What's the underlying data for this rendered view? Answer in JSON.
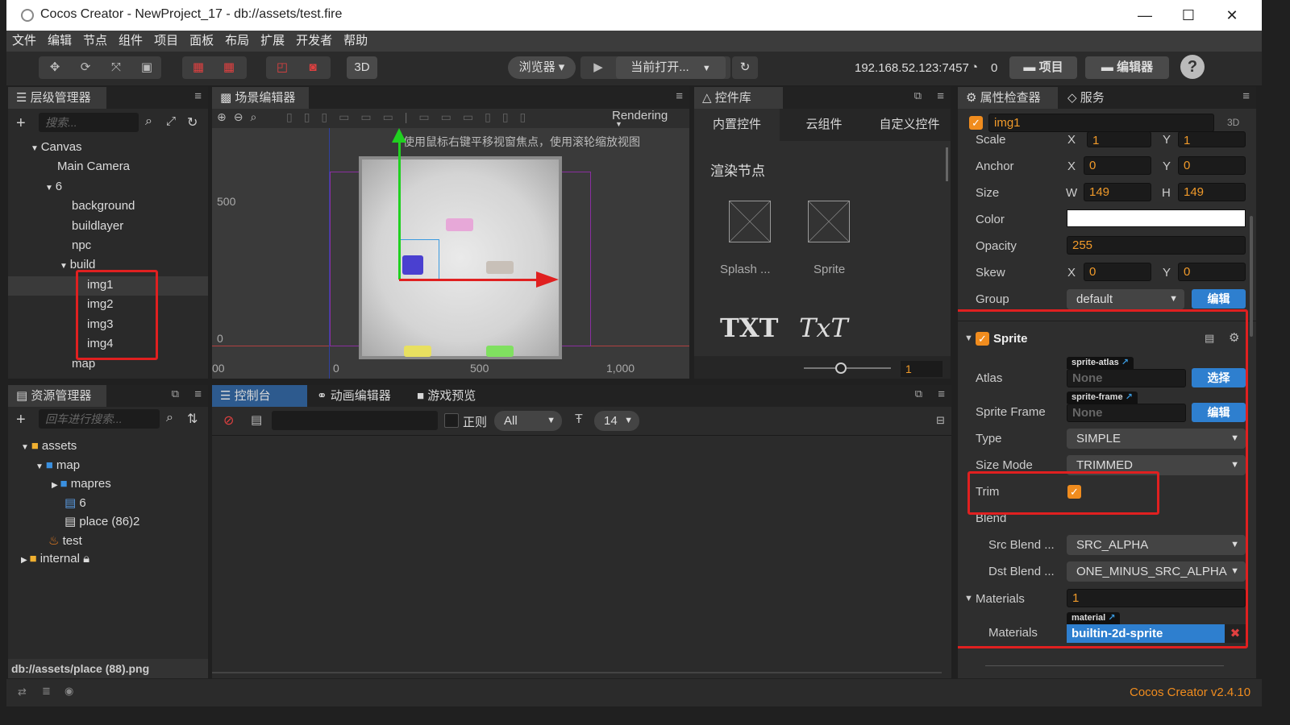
{
  "window": {
    "title": "Cocos Creator - NewProject_17 - db://assets/test.fire"
  },
  "menu": [
    "文件",
    "编辑",
    "节点",
    "组件",
    "项目",
    "面板",
    "布局",
    "扩展",
    "开发者",
    "帮助"
  ],
  "toolbar": {
    "mode_3d": "3D",
    "browser": "浏览器 ▾",
    "current_open": "当前打开...",
    "ip": "192.168.52.123:7457",
    "conn_count": "0",
    "project_btn": "项目",
    "editor_btn": "编辑器"
  },
  "hierarchy": {
    "title": "层级管理器",
    "search_placeholder": "搜索...",
    "nodes": [
      "Canvas",
      "Main Camera",
      "6",
      "background",
      "buildlayer",
      "npc",
      "build",
      "img1",
      "img2",
      "img3",
      "img4",
      "map"
    ]
  },
  "scene": {
    "title": "场景编辑器",
    "rendering": "Rendering",
    "hint": "使用鼠标右键平移视窗焦点，使用滚轮缩放视图",
    "y_labels": [
      "500",
      "0"
    ],
    "x_labels": [
      "00",
      "0",
      "500",
      "1,000"
    ]
  },
  "widgets": {
    "title": "控件库",
    "tabs": [
      "内置控件",
      "云组件",
      "自定义控件"
    ],
    "section": "渲染节点",
    "items": [
      "Splash ...",
      "Sprite"
    ],
    "zoom_value": "1",
    "txt1": "TXT",
    "txt2": "TxT"
  },
  "assets": {
    "title": "资源管理器",
    "search_placeholder": "回车进行搜索...",
    "items": [
      "assets",
      "map",
      "mapres",
      "6",
      "place (86)2",
      "test",
      "internal"
    ],
    "status_path": "db://assets/place (88).png"
  },
  "console": {
    "tabs": [
      "控制台",
      "动画编辑器",
      "游戏预览"
    ],
    "regex_label": "正则",
    "level": "All",
    "font_size": "14"
  },
  "inspector": {
    "title": "属性检查器",
    "service_tab": "服务",
    "node_name": "img1",
    "mode_3d": "3D",
    "scale_label": "Scale",
    "scale_x": "1",
    "scale_y": "1",
    "anchor_label": "Anchor",
    "anchor_x": "0",
    "anchor_y": "0",
    "size_label": "Size",
    "size_w": "149",
    "size_h": "149",
    "color_label": "Color",
    "opacity_label": "Opacity",
    "opacity": "255",
    "skew_label": "Skew",
    "skew_x": "0",
    "skew_y": "0",
    "group_label": "Group",
    "group": "default",
    "edit_btn": "编辑",
    "sprite_title": "Sprite",
    "atlas_label": "Atlas",
    "atlas_tag": "sprite-atlas",
    "atlas_value": "None",
    "select_btn": "选择",
    "frame_label": "Sprite Frame",
    "frame_tag": "sprite-frame",
    "frame_value": "None",
    "frame_edit_btn": "编辑",
    "type_label": "Type",
    "type": "SIMPLE",
    "sizemode_label": "Size Mode",
    "sizemode": "TRIMMED",
    "trim_label": "Trim",
    "blend_label": "Blend",
    "src_label": "Src Blend ...",
    "src": "SRC_ALPHA",
    "dst_label": "Dst Blend ...",
    "dst": "ONE_MINUS_SRC_ALPHA",
    "materials_label": "Materials",
    "materials_count": "1",
    "materials_item_label": "Materials",
    "material_tag": "material",
    "material_value": "builtin-2d-sprite"
  },
  "status": {
    "version": "Cocos Creator v2.4.10"
  },
  "colors": {
    "accent": "#f08c1e",
    "selection_red": "#e02020",
    "button_blue": "#2e7fcf"
  }
}
